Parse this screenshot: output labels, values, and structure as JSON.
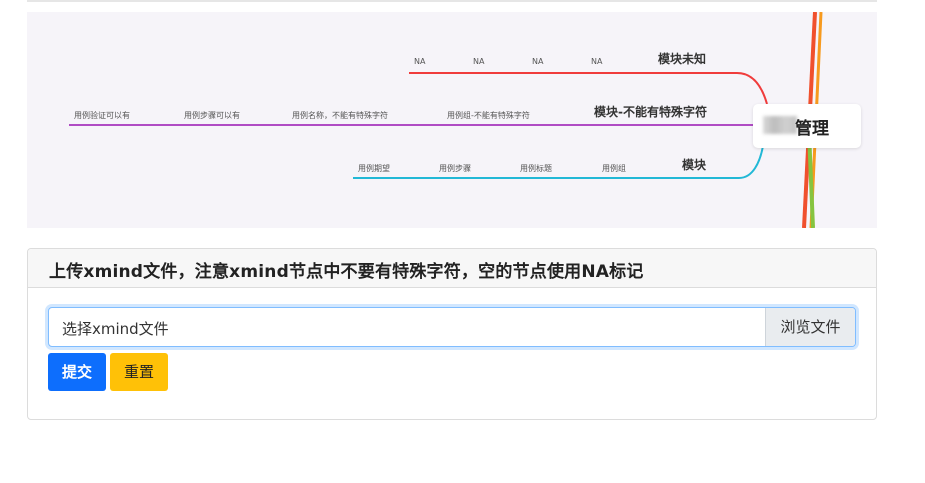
{
  "mindmap": {
    "root_text": "管理",
    "branches": [
      {
        "title": "模块未知",
        "leaves": [
          "NA",
          "NA",
          "NA",
          "NA"
        ]
      },
      {
        "title": "模块-不能有特殊字符",
        "leaves": [
          "用例验证可以有",
          "用例步骤可以有",
          "用例名称，不能有特殊字符",
          "用例组-不能有特殊字符"
        ]
      },
      {
        "title": "模块",
        "leaves": [
          "用例期望",
          "用例步骤",
          "用例标题",
          "用例组"
        ]
      }
    ]
  },
  "upload": {
    "title": "上传xmind文件，注意xmind节点中不要有特殊字符，空的节点使用NA标记",
    "file_placeholder": "选择xmind文件",
    "browse_label": "浏览文件",
    "submit_label": "提交",
    "reset_label": "重置"
  },
  "colors": {
    "branch_red": "#f03c3c",
    "branch_purple": "#b04cc4",
    "branch_cyan": "#22b8d6",
    "submit_blue": "#0d6efd",
    "reset_yellow": "#ffc107"
  }
}
